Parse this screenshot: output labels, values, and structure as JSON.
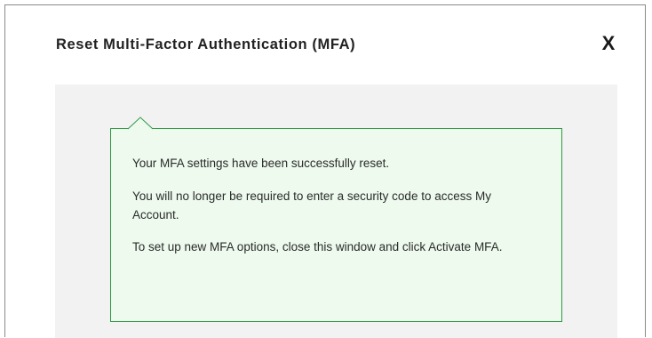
{
  "dialog": {
    "title": "Reset Multi-Factor Authentication (MFA)",
    "close_label": "X"
  },
  "message": {
    "line1": "Your MFA settings have been successfully reset.",
    "line2": "You will no longer be required to enter a security code to access My Account.",
    "line3": "To set up new MFA options, close this window and click Activate MFA."
  },
  "colors": {
    "callout_border": "#2f9a43",
    "callout_background": "#edfaed",
    "panel_background": "#f1f2f1"
  }
}
